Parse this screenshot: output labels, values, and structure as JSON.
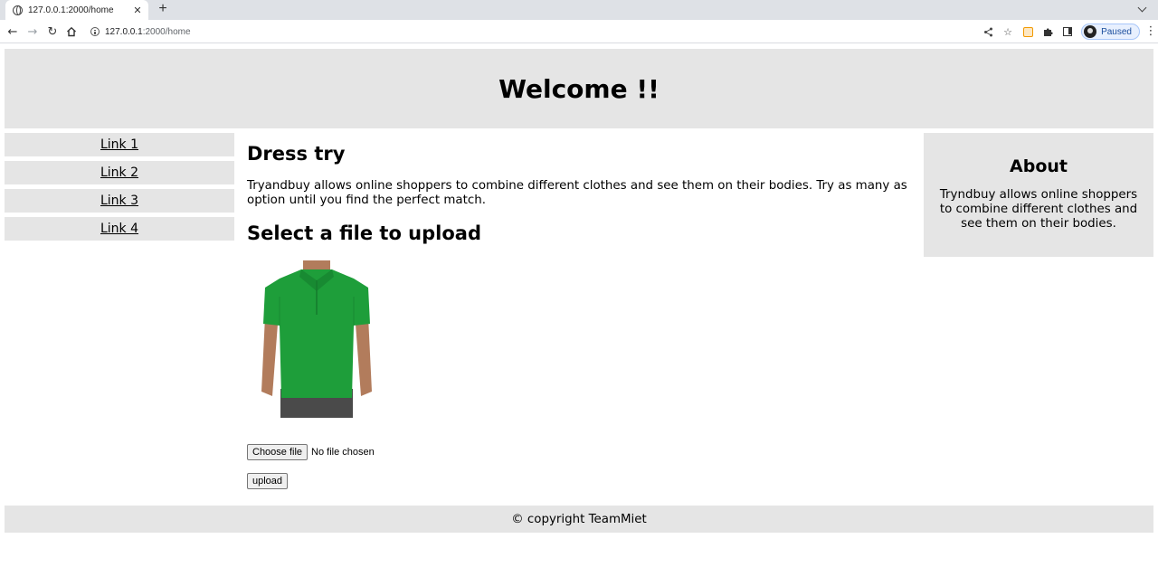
{
  "browser": {
    "tab_title": "127.0.0.1:2000/home",
    "tab_close": "✕",
    "new_tab": "+",
    "url_host": "127.0.0.1",
    "url_path": ":2000/home",
    "profile_status": "Paused"
  },
  "header": {
    "title": "Welcome !!"
  },
  "sidebar": {
    "links": [
      {
        "label": "Link 1"
      },
      {
        "label": "Link 2"
      },
      {
        "label": "Link 3"
      },
      {
        "label": "Link 4"
      }
    ]
  },
  "main": {
    "heading": "Dress try",
    "description": "Tryandbuy allows online shoppers to combine different clothes and see them on their bodies. Try as many as option until you find the perfect match.",
    "upload_heading": "Select a file to upload",
    "choose_file_label": "Choose file",
    "file_status": "No file chosen",
    "upload_label": "upload"
  },
  "about": {
    "heading": "About",
    "text": "Tryndbuy allows online shoppers to combine different clothes and see them on their bodies."
  },
  "footer": {
    "text": "© copyright TeamMiet"
  },
  "colors": {
    "panel_bg": "#e5e5e5",
    "shirt": "#1e9e3a",
    "skin": "#b27c5c",
    "pants": "#4a4a4a"
  }
}
